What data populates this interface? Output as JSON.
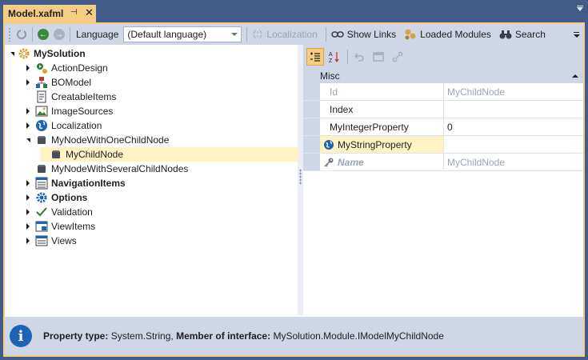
{
  "tab": {
    "title": "Model.xafml",
    "pin_glyph": "⊣",
    "close_glyph": "✕"
  },
  "toolbar": {
    "language_label": "Language",
    "language_value": "(Default language)",
    "localization_label": "Localization",
    "show_links_label": "Show Links",
    "loaded_modules_label": "Loaded Modules",
    "search_label": "Search"
  },
  "tree": {
    "root": "MySolution",
    "items": [
      {
        "label": "ActionDesign",
        "bold": false
      },
      {
        "label": "BOModel",
        "bold": false
      },
      {
        "label": "CreatableItems",
        "bold": false
      },
      {
        "label": "ImageSources",
        "bold": false
      },
      {
        "label": "Localization",
        "bold": false
      },
      {
        "label": "MyNodeWithOneChildNode",
        "bold": false
      },
      {
        "label": "MyChildNode",
        "bold": false
      },
      {
        "label": "MyNodeWithSeveralChildNodes",
        "bold": false
      },
      {
        "label": "NavigationItems",
        "bold": true
      },
      {
        "label": "Options",
        "bold": true
      },
      {
        "label": "Validation",
        "bold": false
      },
      {
        "label": "ViewItems",
        "bold": false
      },
      {
        "label": "Views",
        "bold": false
      }
    ]
  },
  "property_grid": {
    "category": "Misc",
    "rows": [
      {
        "name": "Id",
        "value": "MyChildNode"
      },
      {
        "name": "Index",
        "value": ""
      },
      {
        "name": "MyIntegerProperty",
        "value": "0"
      },
      {
        "name": "MyStringProperty",
        "value": ""
      },
      {
        "name": "Name",
        "value": "MyChildNode"
      }
    ]
  },
  "info": {
    "property_type_label": "Property type:",
    "property_type_value": "System.String,",
    "member_label": "Member of interface:",
    "member_value": "MySolution.Module.IModelMyChildNode"
  }
}
